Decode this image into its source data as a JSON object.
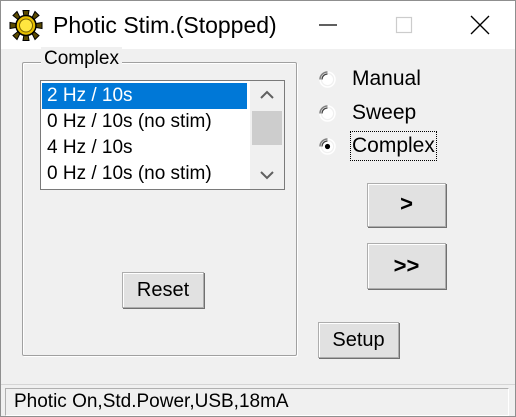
{
  "window": {
    "title": "Photic Stim.(Stopped)",
    "icon": "sun-gear-icon",
    "accent_color": "#0078d7"
  },
  "titlebar": {
    "minimize_icon": "minimize-icon",
    "maximize_icon": "maximize-icon",
    "close_icon": "close-icon"
  },
  "complex_group": {
    "label": "Complex",
    "list_items": [
      {
        "label": "2  Hz / 10s",
        "selected": true
      },
      {
        "label": "0  Hz / 10s (no stim)",
        "selected": false
      },
      {
        "label": "4  Hz / 10s",
        "selected": false
      },
      {
        "label": "0  Hz / 10s (no stim)",
        "selected": false
      }
    ],
    "scroll_up_icon": "chevron-up-icon",
    "scroll_down_icon": "chevron-down-icon",
    "reset_label": "Reset"
  },
  "mode": {
    "options": [
      {
        "label": "Manual",
        "checked": false
      },
      {
        "label": "Sweep",
        "checked": false
      },
      {
        "label": "Complex",
        "checked": true
      }
    ]
  },
  "controls": {
    "next_label": ">",
    "fast_forward_label": ">>",
    "setup_label": "Setup"
  },
  "statusbar": {
    "text": "Photic On,Std.Power,USB,18mA"
  }
}
